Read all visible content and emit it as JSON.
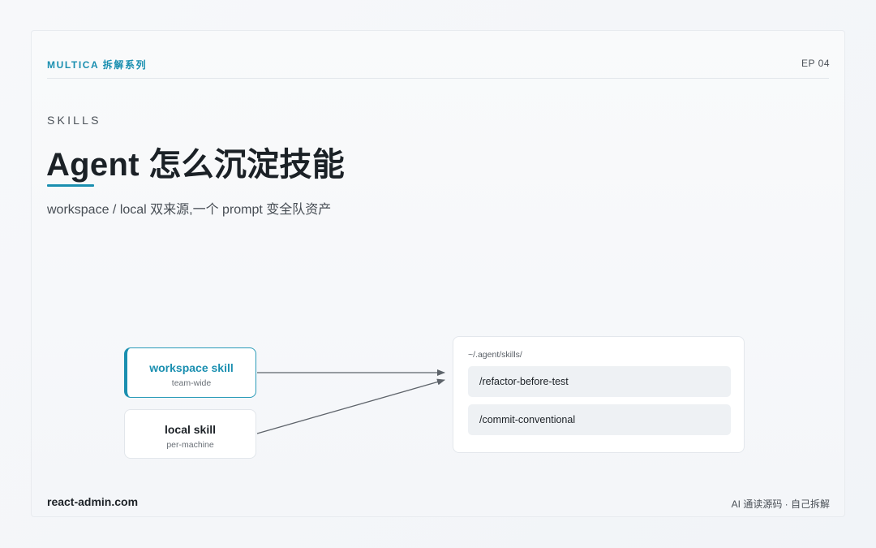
{
  "header": {
    "series": "MULTICA 拆解系列",
    "episode": "EP 04"
  },
  "hero": {
    "eyebrow": "SKILLS",
    "title": "Agent 怎么沉淀技能",
    "subtitle": "workspace / local 双来源,一个 prompt 变全队资产"
  },
  "diagram": {
    "sources": [
      {
        "name": "workspace skill",
        "scope": "team-wide"
      },
      {
        "name": "local skill",
        "scope": "per-machine"
      }
    ],
    "directory": {
      "path": "~/.agent/skills/",
      "items": [
        "/refactor-before-test",
        "/commit-conventional"
      ]
    },
    "colors": {
      "accent": "#1a8fb0",
      "arrow": "#5e646b"
    }
  },
  "footer": {
    "site": "react-admin.com",
    "tagline": "AI 通读源码 · 自己拆解"
  }
}
